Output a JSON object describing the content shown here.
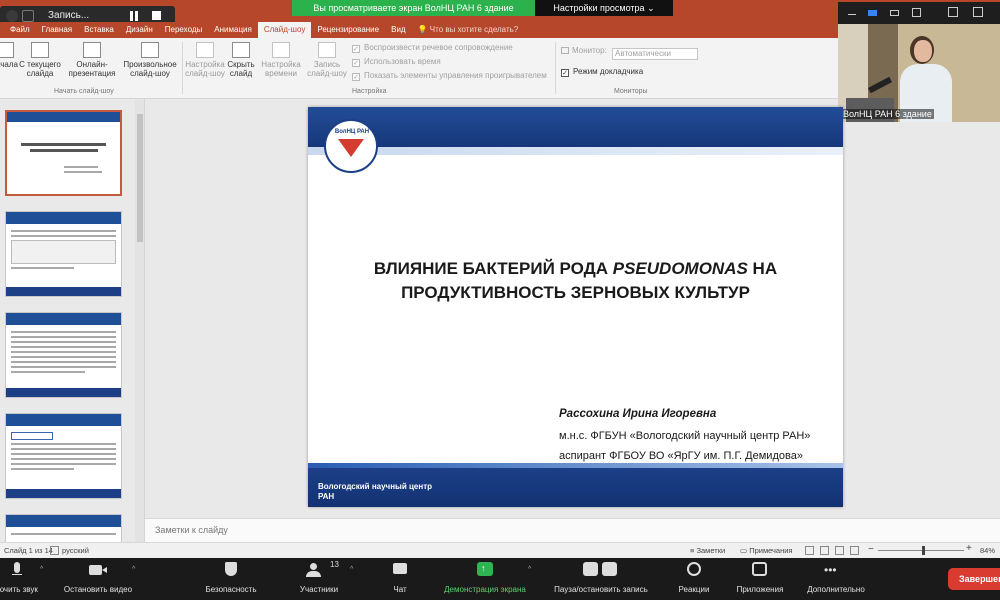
{
  "zoom_meeting": {
    "recording_label": "Запись...",
    "share_banner": "Вы просматриваете экран ВолНЦ РАН 6 здание",
    "view_options": "Настройки просмотра",
    "participant_name": "ВолНЦ РАН 6 здание",
    "end_label": "Завершени",
    "toolbar": [
      {
        "label": "ючить звук",
        "icon": "microphone-icon"
      },
      {
        "label": "Остановить видео",
        "icon": "camera-icon"
      },
      {
        "label": "Безопасность",
        "icon": "shield-icon"
      },
      {
        "label": "Участники",
        "icon": "participants-icon",
        "count": "13"
      },
      {
        "label": "Чат",
        "icon": "chat-icon"
      },
      {
        "label": "Демонстрация экрана",
        "icon": "share-screen-icon"
      },
      {
        "label": "Пауза/остановить запись",
        "icon": "pause-record-icon"
      },
      {
        "label": "Реакции",
        "icon": "emoji-icon"
      },
      {
        "label": "Приложения",
        "icon": "apps-icon"
      },
      {
        "label": "Дополнительно",
        "icon": "more-icon"
      }
    ]
  },
  "powerpoint": {
    "tabs": [
      "Файл",
      "Главная",
      "Вставка",
      "Дизайн",
      "Переходы",
      "Анимация",
      "Слайд-шоу",
      "Рецензирование",
      "Вид"
    ],
    "active_tab": "Слайд-шоу",
    "tell_me": "Что вы хотите сделать?",
    "ribbon": {
      "buttons": [
        "С начала",
        "С текущего слайда",
        "Онлайн-презентация",
        "Произвольное слайд-шоу",
        "Настройка слайд-шоу",
        "Скрыть слайд",
        "Настройка времени",
        "Запись слайд-шоу"
      ],
      "groups": [
        "Начать слайд-шоу",
        "Настройка",
        "Мониторы"
      ],
      "checkboxes": [
        {
          "label": "Воспроизвести речевое сопровождение",
          "checked": true
        },
        {
          "label": "Использовать время",
          "checked": true
        },
        {
          "label": "Показать элементы управления проигрывателем",
          "checked": true
        }
      ],
      "monitor_label": "Монитор:",
      "monitor_value": "Автоматически",
      "presenter_view": {
        "label": "Режим докладчика",
        "checked": true
      }
    },
    "slide": {
      "logo_text": "ВолНЦ РАН",
      "title_part1": "ВЛИЯНИЕ БАКТЕРИЙ РОДА ",
      "title_italic": "PSEUDOMONAS",
      "title_part2": " НА ПРОДУКТИВНОСТЬ ЗЕРНОВЫХ КУЛЬТУР",
      "author": "Рассохина Ирина Игоревна",
      "position1": "м.н.с. ФГБУН «Вологодский научный центр РАН»",
      "position2": "аспирант ФГБОУ ВО «ЯрГУ им. П.Г. Демидова»",
      "organization": "Вологодский научный центр РАН"
    },
    "thumbnail_count": 5,
    "notes_placeholder": "Заметки к слайду",
    "status": {
      "slide_counter": "Слайд 1 из 14",
      "language": "русский",
      "notes": "Заметки",
      "comments": "Примечания",
      "zoom": "84%"
    }
  }
}
